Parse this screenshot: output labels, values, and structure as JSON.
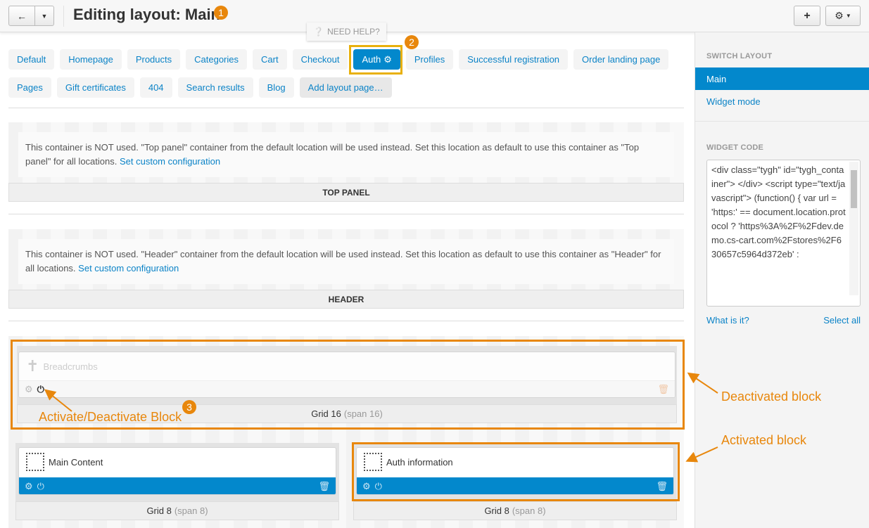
{
  "header": {
    "title": "Editing layout: Main",
    "back_icon": "arrow-left-icon",
    "dropdown_icon": "caret-down-icon",
    "add_icon": "plus-icon",
    "settings_icon": "gear-icon"
  },
  "help": {
    "label": "NEED HELP?",
    "icon": "question-circle-icon"
  },
  "tabs": {
    "row1": [
      "Default",
      "Homepage",
      "Products",
      "Categories",
      "Cart",
      "Checkout",
      "Auth",
      "Profiles",
      "Successful registration",
      "Order landing page"
    ],
    "row2": [
      "Pages",
      "Gift certificates",
      "404",
      "Search results",
      "Blog",
      "Add layout page…"
    ],
    "active": "Auth"
  },
  "containers": [
    {
      "note": "This container is NOT used. \"Top panel\" container from the default location will be used instead. Set this location as default to use this container as \"Top panel\" for all locations.",
      "link": "Set custom configuration",
      "title": "TOP PANEL"
    },
    {
      "note": "This container is NOT used. \"Header\" container from the default location will be used instead. Set this location as default to use this container as \"Header\" for all locations.",
      "link": "Set custom configuration",
      "title": "HEADER"
    }
  ],
  "grids": [
    {
      "name": "Grid 16",
      "span": "(span 16)",
      "block": "Breadcrumbs",
      "active": false
    },
    {
      "name": "Grid 8",
      "span": "(span 8)",
      "block": "Main Content",
      "active": true
    },
    {
      "name": "Grid 8",
      "span": "(span 8)",
      "block": "Auth information",
      "active": true
    }
  ],
  "annotations": {
    "b1": "1",
    "b2": "2",
    "b3": "3",
    "activate": "Activate/Deactivate Block",
    "deactivated": "Deactivated block",
    "activated": "Activated block"
  },
  "sidebar": {
    "switch_title": "SWITCH LAYOUT",
    "items": [
      "Main",
      "Widget mode"
    ],
    "widget_title": "WIDGET CODE",
    "code": "<div class=\"tygh\" id=\"tygh_container\"> </div> <script type=\"text/javascript\"> (function() { var url = 'https:' == document.location.protocol ? 'https%3A%2F%2Fdev.demo.cs-cart.com%2Fstores%2F630657c5964d372eb' :",
    "what": "What is it?",
    "select_all": "Select all"
  },
  "colors": {
    "accent": "#0388cc",
    "annotation": "#e8870c"
  }
}
